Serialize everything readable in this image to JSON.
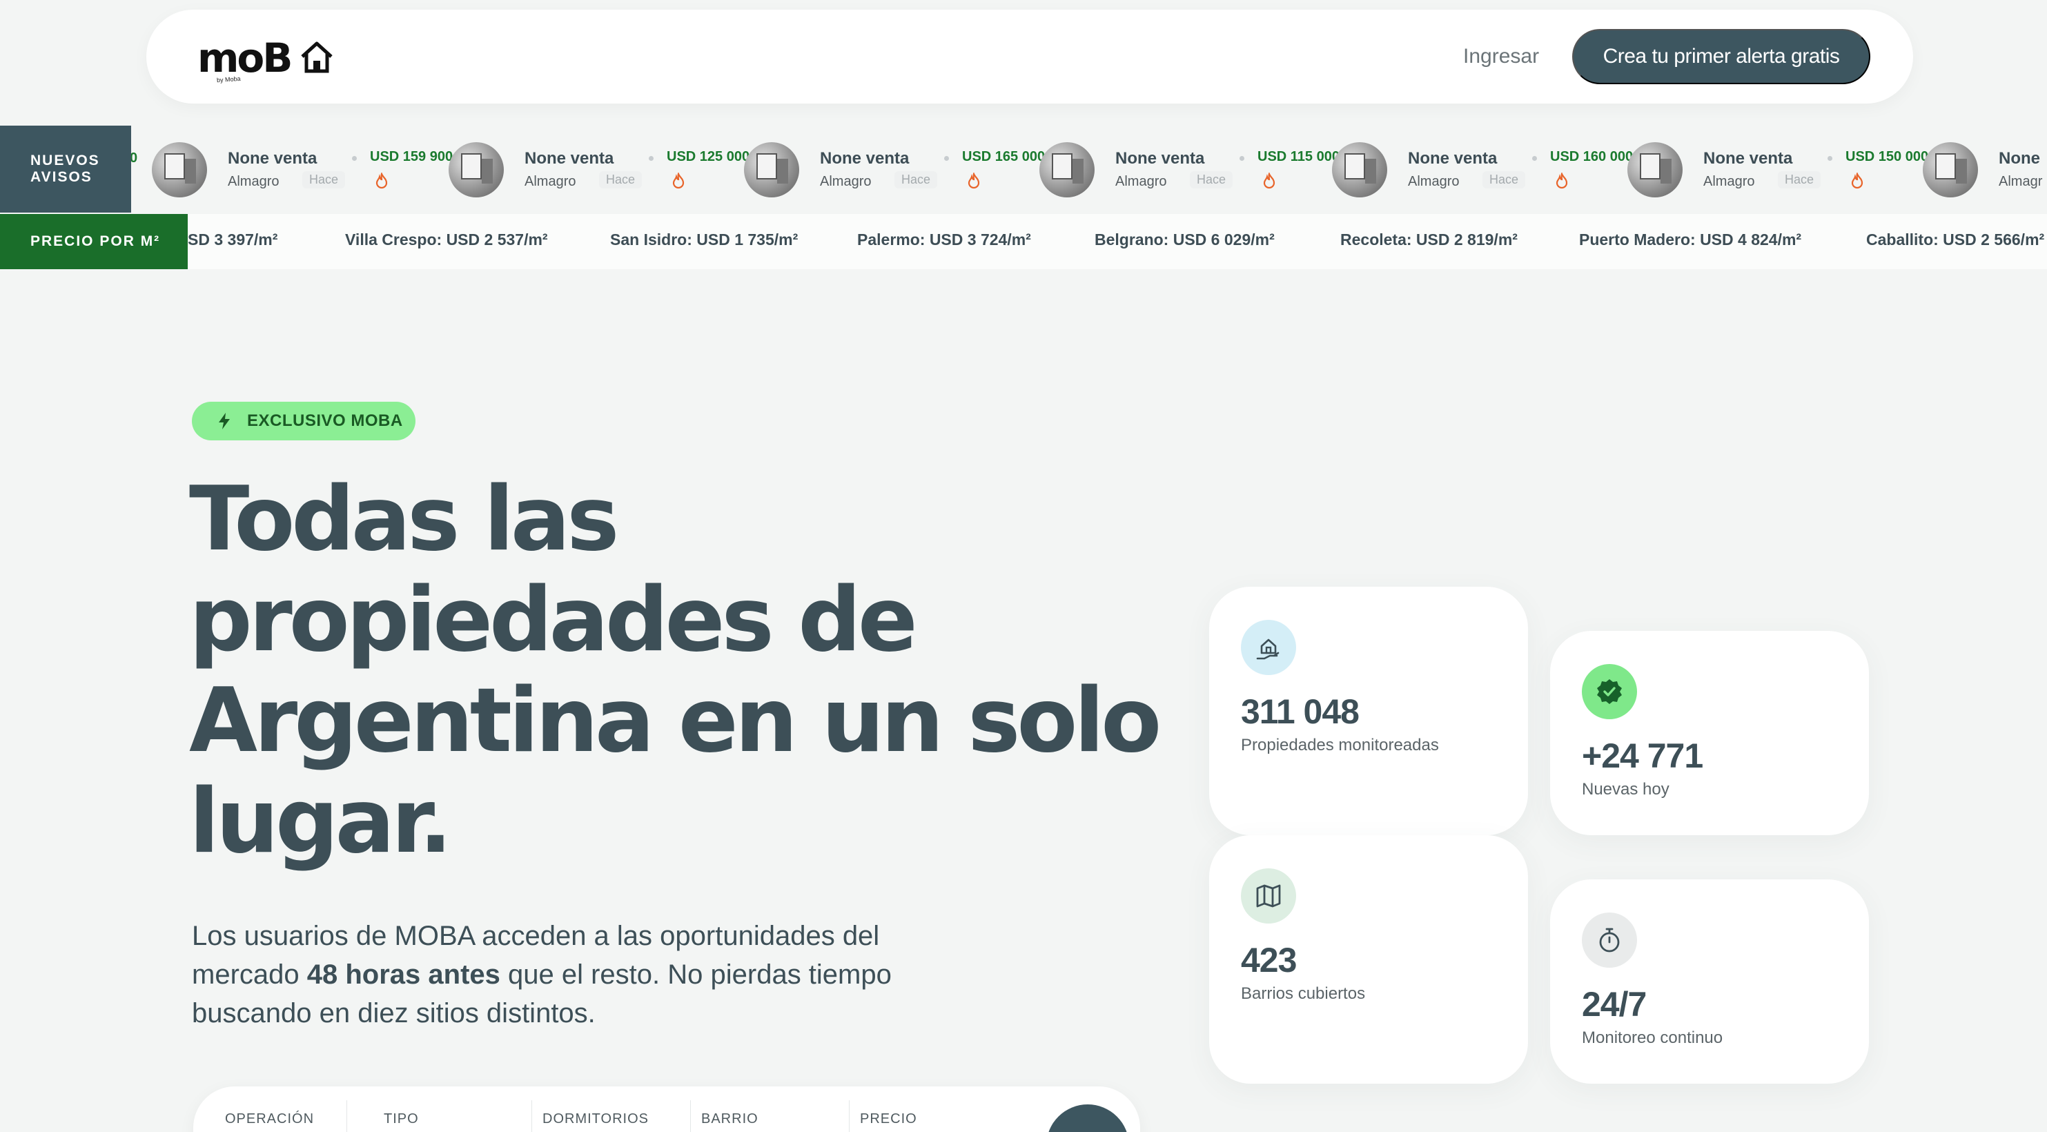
{
  "navbar": {
    "logo_text": "moB",
    "logo_tagline": "by Moba",
    "login_label": "Ingresar",
    "cta_label": "Crea tu primer alerta gratis"
  },
  "ticker": {
    "new_label_line1": "NUEVOS",
    "new_label_line2": "AVISOS",
    "price_label": "PRECIO POR M²",
    "cut_price": "0",
    "listings": [
      {
        "title": "None venta",
        "price": "USD 159 900",
        "area": "Almagro",
        "time": "Hace"
      },
      {
        "title": "None venta",
        "price": "USD 125 000",
        "area": "Almagro",
        "time": "Hace"
      },
      {
        "title": "None venta",
        "price": "USD 165 000",
        "area": "Almagro",
        "time": "Hace"
      },
      {
        "title": "None venta",
        "price": "USD 115 000",
        "area": "Almagro",
        "time": "Hace"
      },
      {
        "title": "None venta",
        "price": "USD 160 000",
        "area": "Almagro",
        "time": "Hace"
      },
      {
        "title": "None venta",
        "price": "USD 150 000",
        "area": "Almagro",
        "time": "Hace"
      },
      {
        "title": "None",
        "price": "",
        "area": "Almagr",
        "time": ""
      }
    ],
    "prices": [
      "SD 3 397/m²",
      "Villa Crespo: USD 2 537/m²",
      "San Isidro: USD 1 735/m²",
      "Palermo: USD 3 724/m²",
      "Belgrano: USD 6 029/m²",
      "Recoleta: USD 2 819/m²",
      "Puerto Madero: USD 4 824/m²",
      "Caballito: USD 2 566/m²"
    ]
  },
  "hero": {
    "badge": "EXCLUSIVO MOBA",
    "title_line1": "Todas las",
    "title_line2": "propiedades de",
    "title_line3": "Argentina en un solo",
    "title_line4": "lugar.",
    "sub_part1": "Los usuarios de MOBA acceden a las oportunidades del mercado ",
    "sub_strong": "48 horas antes",
    "sub_part2": " que el resto. No pierdas tiempo buscando en diez sitios distintos."
  },
  "search": {
    "fields": [
      "OPERACIÓN",
      "TIPO",
      "DORMITORIOS",
      "BARRIO",
      "PRECIO"
    ]
  },
  "stats": [
    {
      "value": "311 048",
      "label": "Propiedades monitoreadas",
      "icon": "house-hand-icon",
      "icon_bg": "#d4eef7"
    },
    {
      "value": "+24 771",
      "label": "Nuevas hoy",
      "icon": "verified-badge-icon",
      "icon_bg": "#7fe88a"
    },
    {
      "value": "423",
      "label": "Barrios cubiertos",
      "icon": "map-icon",
      "icon_bg": "#ddeee2"
    },
    {
      "value": "24/7",
      "label": "Monitoreo continuo",
      "icon": "stopwatch-icon",
      "icon_bg": "#e9ebeb"
    }
  ],
  "colors": {
    "primary": "#3d5660",
    "accent_green": "#1a6e2a",
    "badge_green": "#8bee94",
    "price_green": "#1a7a2e"
  }
}
